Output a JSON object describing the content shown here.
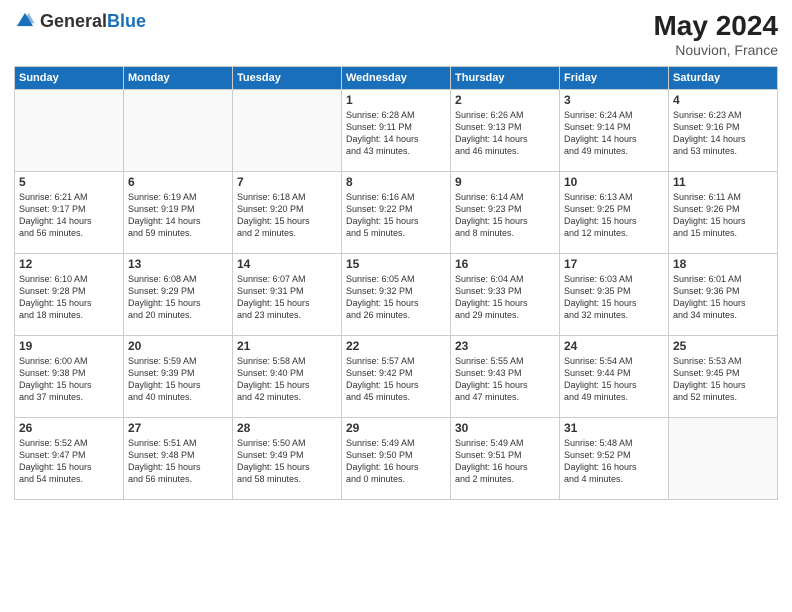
{
  "header": {
    "logo_general": "General",
    "logo_blue": "Blue",
    "month_year": "May 2024",
    "location": "Nouvion, France"
  },
  "days_of_week": [
    "Sunday",
    "Monday",
    "Tuesday",
    "Wednesday",
    "Thursday",
    "Friday",
    "Saturday"
  ],
  "weeks": [
    [
      {
        "day": "",
        "info": ""
      },
      {
        "day": "",
        "info": ""
      },
      {
        "day": "",
        "info": ""
      },
      {
        "day": "1",
        "info": "Sunrise: 6:28 AM\nSunset: 9:11 PM\nDaylight: 14 hours\nand 43 minutes."
      },
      {
        "day": "2",
        "info": "Sunrise: 6:26 AM\nSunset: 9:13 PM\nDaylight: 14 hours\nand 46 minutes."
      },
      {
        "day": "3",
        "info": "Sunrise: 6:24 AM\nSunset: 9:14 PM\nDaylight: 14 hours\nand 49 minutes."
      },
      {
        "day": "4",
        "info": "Sunrise: 6:23 AM\nSunset: 9:16 PM\nDaylight: 14 hours\nand 53 minutes."
      }
    ],
    [
      {
        "day": "5",
        "info": "Sunrise: 6:21 AM\nSunset: 9:17 PM\nDaylight: 14 hours\nand 56 minutes."
      },
      {
        "day": "6",
        "info": "Sunrise: 6:19 AM\nSunset: 9:19 PM\nDaylight: 14 hours\nand 59 minutes."
      },
      {
        "day": "7",
        "info": "Sunrise: 6:18 AM\nSunset: 9:20 PM\nDaylight: 15 hours\nand 2 minutes."
      },
      {
        "day": "8",
        "info": "Sunrise: 6:16 AM\nSunset: 9:22 PM\nDaylight: 15 hours\nand 5 minutes."
      },
      {
        "day": "9",
        "info": "Sunrise: 6:14 AM\nSunset: 9:23 PM\nDaylight: 15 hours\nand 8 minutes."
      },
      {
        "day": "10",
        "info": "Sunrise: 6:13 AM\nSunset: 9:25 PM\nDaylight: 15 hours\nand 12 minutes."
      },
      {
        "day": "11",
        "info": "Sunrise: 6:11 AM\nSunset: 9:26 PM\nDaylight: 15 hours\nand 15 minutes."
      }
    ],
    [
      {
        "day": "12",
        "info": "Sunrise: 6:10 AM\nSunset: 9:28 PM\nDaylight: 15 hours\nand 18 minutes."
      },
      {
        "day": "13",
        "info": "Sunrise: 6:08 AM\nSunset: 9:29 PM\nDaylight: 15 hours\nand 20 minutes."
      },
      {
        "day": "14",
        "info": "Sunrise: 6:07 AM\nSunset: 9:31 PM\nDaylight: 15 hours\nand 23 minutes."
      },
      {
        "day": "15",
        "info": "Sunrise: 6:05 AM\nSunset: 9:32 PM\nDaylight: 15 hours\nand 26 minutes."
      },
      {
        "day": "16",
        "info": "Sunrise: 6:04 AM\nSunset: 9:33 PM\nDaylight: 15 hours\nand 29 minutes."
      },
      {
        "day": "17",
        "info": "Sunrise: 6:03 AM\nSunset: 9:35 PM\nDaylight: 15 hours\nand 32 minutes."
      },
      {
        "day": "18",
        "info": "Sunrise: 6:01 AM\nSunset: 9:36 PM\nDaylight: 15 hours\nand 34 minutes."
      }
    ],
    [
      {
        "day": "19",
        "info": "Sunrise: 6:00 AM\nSunset: 9:38 PM\nDaylight: 15 hours\nand 37 minutes."
      },
      {
        "day": "20",
        "info": "Sunrise: 5:59 AM\nSunset: 9:39 PM\nDaylight: 15 hours\nand 40 minutes."
      },
      {
        "day": "21",
        "info": "Sunrise: 5:58 AM\nSunset: 9:40 PM\nDaylight: 15 hours\nand 42 minutes."
      },
      {
        "day": "22",
        "info": "Sunrise: 5:57 AM\nSunset: 9:42 PM\nDaylight: 15 hours\nand 45 minutes."
      },
      {
        "day": "23",
        "info": "Sunrise: 5:55 AM\nSunset: 9:43 PM\nDaylight: 15 hours\nand 47 minutes."
      },
      {
        "day": "24",
        "info": "Sunrise: 5:54 AM\nSunset: 9:44 PM\nDaylight: 15 hours\nand 49 minutes."
      },
      {
        "day": "25",
        "info": "Sunrise: 5:53 AM\nSunset: 9:45 PM\nDaylight: 15 hours\nand 52 minutes."
      }
    ],
    [
      {
        "day": "26",
        "info": "Sunrise: 5:52 AM\nSunset: 9:47 PM\nDaylight: 15 hours\nand 54 minutes."
      },
      {
        "day": "27",
        "info": "Sunrise: 5:51 AM\nSunset: 9:48 PM\nDaylight: 15 hours\nand 56 minutes."
      },
      {
        "day": "28",
        "info": "Sunrise: 5:50 AM\nSunset: 9:49 PM\nDaylight: 15 hours\nand 58 minutes."
      },
      {
        "day": "29",
        "info": "Sunrise: 5:49 AM\nSunset: 9:50 PM\nDaylight: 16 hours\nand 0 minutes."
      },
      {
        "day": "30",
        "info": "Sunrise: 5:49 AM\nSunset: 9:51 PM\nDaylight: 16 hours\nand 2 minutes."
      },
      {
        "day": "31",
        "info": "Sunrise: 5:48 AM\nSunset: 9:52 PM\nDaylight: 16 hours\nand 4 minutes."
      },
      {
        "day": "",
        "info": ""
      }
    ]
  ]
}
